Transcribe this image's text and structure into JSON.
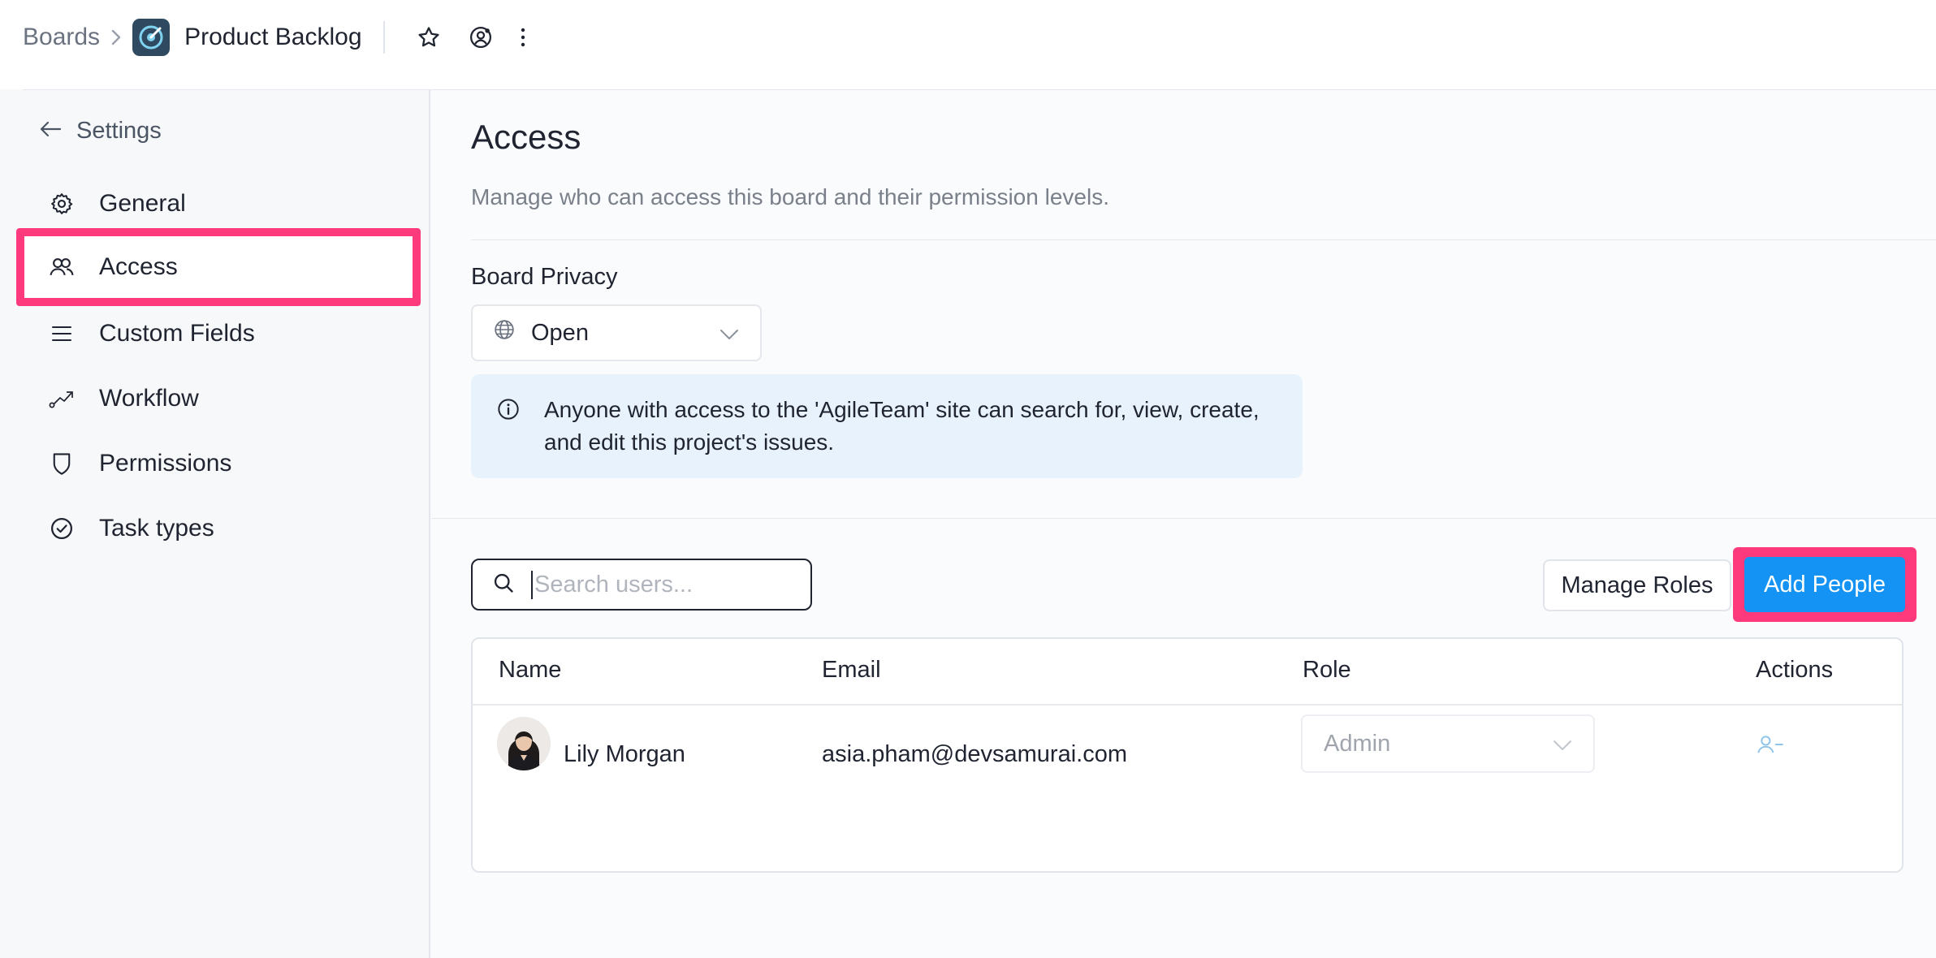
{
  "breadcrumb": {
    "root": "Boards",
    "board_title": "Product Backlog"
  },
  "sidebar": {
    "back_label": "Settings",
    "items": [
      {
        "label": "General",
        "icon": "gear-icon"
      },
      {
        "label": "Access",
        "icon": "people-icon",
        "active": true
      },
      {
        "label": "Custom Fields",
        "icon": "list-icon"
      },
      {
        "label": "Workflow",
        "icon": "workflow-icon"
      },
      {
        "label": "Permissions",
        "icon": "shield-icon"
      },
      {
        "label": "Task types",
        "icon": "check-circle-icon"
      }
    ]
  },
  "page": {
    "title": "Access",
    "subtitle": "Manage who can access this board and their permission levels."
  },
  "privacy": {
    "label": "Board Privacy",
    "value": "Open",
    "info": "Anyone with access to the 'AgileTeam' site can search for, view, create, and edit this project's issues."
  },
  "toolbar": {
    "search_placeholder": "Search users...",
    "manage_roles": "Manage Roles",
    "add_people": "Add People"
  },
  "table": {
    "headers": [
      "Name",
      "Email",
      "Role",
      "Actions"
    ],
    "rows": [
      {
        "name": "Lily Morgan",
        "email": "asia.pham@devsamurai.com",
        "role": "Admin"
      }
    ]
  },
  "colors": {
    "accent": "#1493f4",
    "highlight": "#ff3a7c",
    "info_bg": "#e8f2fc"
  }
}
